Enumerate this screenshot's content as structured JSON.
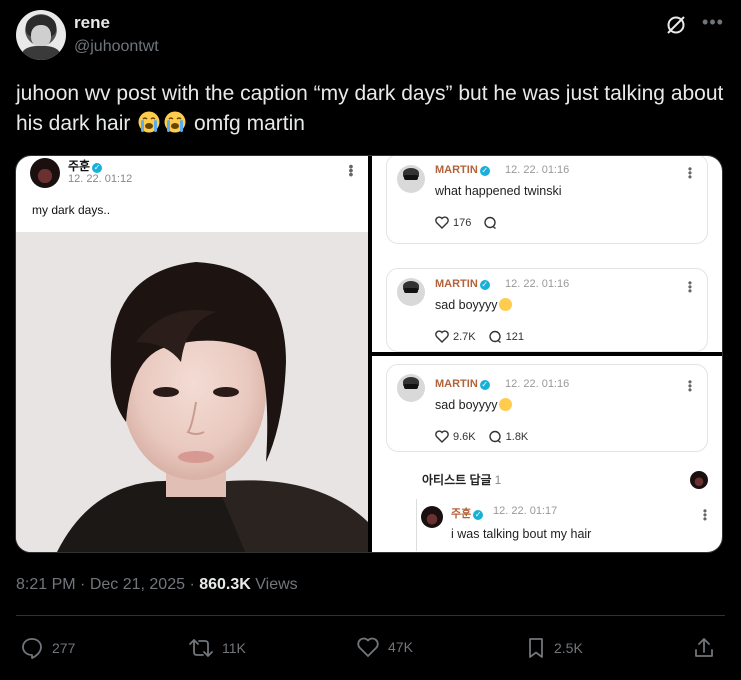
{
  "author": {
    "display_name": "rene",
    "handle": "@juhoontwt"
  },
  "tweet": {
    "text_before": "juhoon wv post with the caption “my dark days” but he was just talking about his dark hair ",
    "text_after": " omfg martin",
    "emojis": [
      "loudly-crying-face",
      "loudly-crying-face"
    ]
  },
  "media": {
    "post": {
      "author_name": "주훈",
      "date": "12. 22. 01:12",
      "caption": "my dark days.."
    },
    "comment1": {
      "name": "MARTIN",
      "date": "12. 22. 01:16",
      "text": "what happened twinski",
      "likes": "176",
      "replies": ""
    },
    "comment2": {
      "name": "MARTIN",
      "date": "12. 22. 01:16",
      "text": "sad boyyyy",
      "likes": "2.7K",
      "replies": "121"
    },
    "comment3": {
      "name": "MARTIN",
      "date": "12. 22. 01:16",
      "text": "sad boyyyy",
      "likes": "9.6K",
      "replies": "1.8K"
    },
    "artist_replies": {
      "label": "아티스트 답글",
      "count": "1"
    },
    "reply": {
      "name": "주훈",
      "date": "12. 22. 01:17",
      "text": "i was talking bout my hair"
    }
  },
  "meta": {
    "time": "8:21 PM",
    "date": "Dec 21, 2025",
    "views_count": "860.3K",
    "views_label": "Views"
  },
  "actions": {
    "replies": "277",
    "reposts": "11K",
    "likes": "47K",
    "bookmarks": "2.5K"
  },
  "colors": {
    "background": "#000000",
    "text": "#e7e9ea",
    "secondary": "#71767b",
    "verified": "#19b0d8",
    "commenter_name": "#b3623a"
  }
}
